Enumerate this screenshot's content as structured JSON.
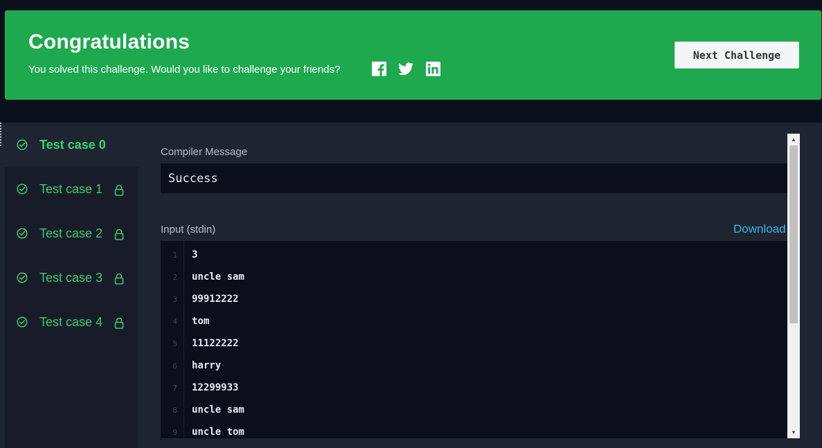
{
  "banner": {
    "title": "Congratulations",
    "subtitle": "You solved this challenge. Would you like to challenge your friends?",
    "share_icons": [
      "facebook-icon",
      "twitter-icon",
      "linkedin-icon"
    ],
    "next_button": "Next Challenge",
    "color": "#1ea94f"
  },
  "sidebar": {
    "test_cases": [
      {
        "label": "Test case 0",
        "status": "passed",
        "locked": false,
        "active": true
      },
      {
        "label": "Test case 1",
        "status": "passed",
        "locked": true,
        "active": false
      },
      {
        "label": "Test case 2",
        "status": "passed",
        "locked": true,
        "active": false
      },
      {
        "label": "Test case 3",
        "status": "passed",
        "locked": true,
        "active": false
      },
      {
        "label": "Test case 4",
        "status": "passed",
        "locked": true,
        "active": false
      }
    ]
  },
  "compiler": {
    "label": "Compiler Message",
    "message": "Success"
  },
  "input": {
    "label": "Input (stdin)",
    "download": "Download",
    "lines": [
      {
        "n": "1",
        "text": "3"
      },
      {
        "n": "2",
        "text": "uncle sam"
      },
      {
        "n": "3",
        "text": "99912222"
      },
      {
        "n": "4",
        "text": "tom"
      },
      {
        "n": "5",
        "text": "11122222"
      },
      {
        "n": "6",
        "text": "harry"
      },
      {
        "n": "7",
        "text": "12299933"
      },
      {
        "n": "8",
        "text": "uncle sam"
      },
      {
        "n": "9",
        "text": "uncle tom"
      }
    ]
  },
  "colors": {
    "accent_green": "#3ec973",
    "link_blue": "#39b4e8",
    "background": "#0b0f1c"
  }
}
